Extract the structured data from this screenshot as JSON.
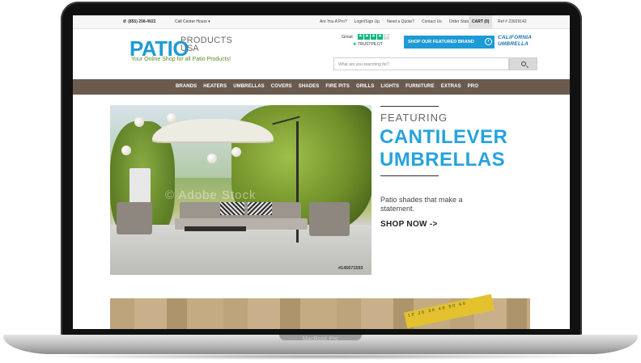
{
  "device": {
    "label": "MacBook Pro"
  },
  "topbar": {
    "phone": "(855) 298-4922",
    "call_center_hours": "Call Center Hours ▾",
    "links": [
      "Are You A Pro?",
      "Login/Sign Up",
      "Need a Quote?",
      "Contact Us",
      "Order Status"
    ],
    "cart": "CART (0)",
    "ref": "Ref # 23929142"
  },
  "header": {
    "logo_patio": "PATIO",
    "logo_products": "PRODUCTS",
    "logo_usa": "USA",
    "tagline": "Your Online Shop for all Patio Products!",
    "trust_great": "Great",
    "trust_pilot": "TRUSTPILOT",
    "featured_button": "SHOP OUR FEATURED BRAND",
    "featured_brand_line1": "CALIFORNIA",
    "featured_brand_line2": "UMBRELLA",
    "search_placeholder": "What are you searching for?"
  },
  "nav": {
    "items": [
      "BRANDS",
      "HEATERS",
      "UMBRELLAS",
      "COVERS",
      "SHADES",
      "FIRE PITS",
      "GRILLS",
      "LIGHTS",
      "FURNITURE",
      "EXTRAS",
      "PRO"
    ]
  },
  "hero": {
    "watermark": "© Adobe Stock",
    "image_id": "#145671593",
    "featuring": "FEATURING",
    "headline_line1": "CANTILEVER",
    "headline_line2": "UMBRELLAS",
    "subtext": "Patio shades that make a statement.",
    "cta": "SHOP NOW ->"
  },
  "banner": {
    "ruler_text": "10 20 30 40 50 60"
  },
  "colors": {
    "brand_blue": "#1e9ad6",
    "nav_brown": "#6b5b4f",
    "tagline_green": "#5a8c2e",
    "trustpilot_green": "#00b67a"
  }
}
